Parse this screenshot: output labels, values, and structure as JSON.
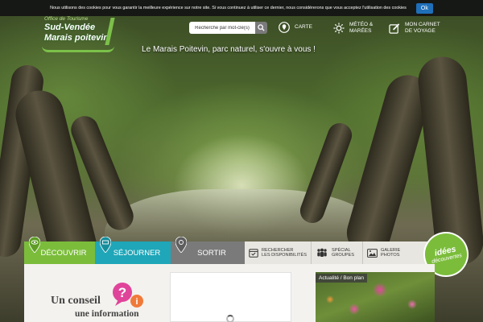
{
  "cookie": {
    "text": "Nous utilisons des cookies pour vous garantir la meilleure expérience sur notre site. Si vous continuez à utiliser ce dernier, nous considérerons que vous acceptez l'utilisation des cookies",
    "ok_label": "Ok"
  },
  "logo": {
    "top": "Office de Tourisme",
    "line1": "Sud-Vendée",
    "line2": "Marais poitevin"
  },
  "search": {
    "placeholder": "Recherche par mot-clé(s)"
  },
  "top_links": {
    "map": {
      "label": "CARTE",
      "icon": "map-pin-icon"
    },
    "weather": {
      "line1": "MÉTÉO &",
      "line2": "MARÉES",
      "icon": "sun-icon"
    },
    "notebook": {
      "line1": "MON CARNET",
      "line2": "DE VOYAGE",
      "icon": "edit-icon"
    }
  },
  "tagline": "Le Marais Poitevin, parc naturel, s'ouvre à vous !",
  "nav": {
    "discover": "DÉCOUVRIR",
    "stay": "SÉJOURNER",
    "out": "SORTIR"
  },
  "sub_nav": {
    "search": {
      "line1": "RECHERCHER",
      "line2": "LES DISPONIBILITÉS"
    },
    "groups": {
      "line1": "SPÉCIAL",
      "line2": "GROUPES"
    },
    "photos": {
      "line1": "GALERIE",
      "line2": "PHOTOS"
    }
  },
  "idees": {
    "line1": "idées",
    "line2": "découvertes"
  },
  "tip": {
    "title": "Un conseil",
    "subtitle": "une information"
  },
  "news": {
    "tag": "Actualité / Bon plan"
  },
  "colors": {
    "green": "#7bbd3b",
    "teal": "#1fa6b8",
    "gray": "#7a7a7a",
    "pink": "#e0449a"
  }
}
